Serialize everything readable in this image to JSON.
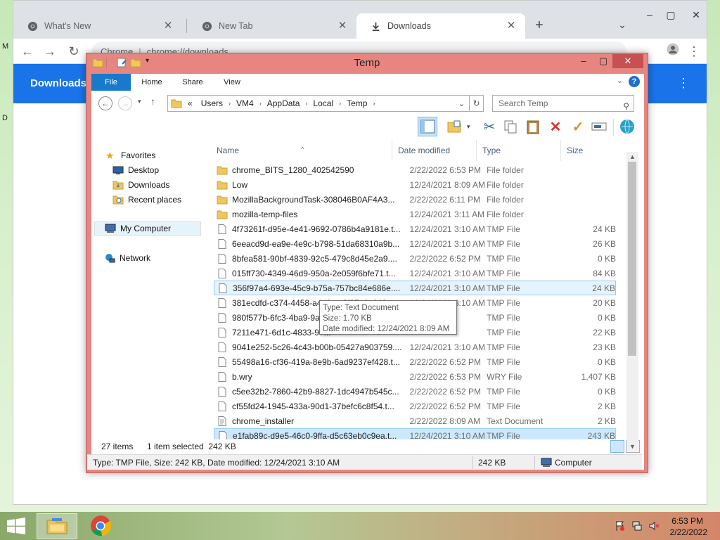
{
  "desktop": {
    "edge_letters": [
      "M",
      "D"
    ]
  },
  "chrome": {
    "tabs": [
      {
        "label": "What's New",
        "icon": "chrome-logo-icon"
      },
      {
        "label": "New Tab",
        "icon": "chrome-logo-icon"
      },
      {
        "label": "Downloads",
        "icon": "download-icon"
      }
    ],
    "omnibox": {
      "site": "Chrome",
      "url": "chrome://downloads"
    },
    "page_title": "Downloads",
    "accent": "#1a73e8"
  },
  "explorer": {
    "title": "Temp",
    "ribbon_tabs": [
      "File",
      "Home",
      "Share",
      "View"
    ],
    "address": [
      "Users",
      "VM4",
      "AppData",
      "Local",
      "Temp"
    ],
    "address_prefix": "«",
    "search_placeholder": "Search Temp",
    "nav": {
      "favorites": "Favorites",
      "desktop": "Desktop",
      "downloads": "Downloads",
      "recent": "Recent places",
      "computer": "My Computer",
      "network": "Network"
    },
    "columns": {
      "name": "Name",
      "date": "Date modified",
      "type": "Type",
      "size": "Size"
    },
    "files": [
      {
        "name": "chrome_BITS_1280_402542590",
        "date": "2/22/2022 6:53 PM",
        "type": "File folder",
        "size": "",
        "icon": "folder-icon"
      },
      {
        "name": "Low",
        "date": "12/24/2021 8:09 AM",
        "type": "File folder",
        "size": "",
        "icon": "folder-icon"
      },
      {
        "name": "MozillaBackgroundTask-308046B0AF4A3...",
        "date": "2/22/2022 6:11 PM",
        "type": "File folder",
        "size": "",
        "icon": "folder-icon"
      },
      {
        "name": "mozilla-temp-files",
        "date": "12/24/2021 3:11 AM",
        "type": "File folder",
        "size": "",
        "icon": "folder-icon"
      },
      {
        "name": "4f73261f-d95e-4e41-9692-0786b4a9181e.t...",
        "date": "12/24/2021 3:10 AM",
        "type": "TMP File",
        "size": "24 KB",
        "icon": "file-icon"
      },
      {
        "name": "6eeacd9d-ea9e-4e9c-b798-51da68310a9b...",
        "date": "12/24/2021 3:10 AM",
        "type": "TMP File",
        "size": "26 KB",
        "icon": "file-icon"
      },
      {
        "name": "8bfea581-90bf-4839-92c5-479c8d45e2a9....",
        "date": "2/22/2022 6:52 PM",
        "type": "TMP File",
        "size": "0 KB",
        "icon": "file-icon"
      },
      {
        "name": "015ff730-4349-46d9-950a-2e059f6bfe71.t...",
        "date": "12/24/2021 3:10 AM",
        "type": "TMP File",
        "size": "84 KB",
        "icon": "file-icon"
      },
      {
        "name": "356f97a4-693e-45c9-b75a-757bc84e686e....",
        "date": "12/24/2021 3:10 AM",
        "type": "TMP File",
        "size": "24 KB",
        "icon": "file-icon",
        "state": "hover"
      },
      {
        "name": "381ecdfd-c374-4458-a4d3-ac3f87e0c643...",
        "date": "12/24/2021 3:10 AM",
        "type": "TMP File",
        "size": "20 KB",
        "icon": "file-icon"
      },
      {
        "name": "980f577b-6fc3-4ba9-9a7...",
        "date": "",
        "type": "TMP File",
        "size": "0 KB",
        "icon": "file-icon"
      },
      {
        "name": "7211e471-6d1c-4833-97...",
        "date": "",
        "type": "TMP File",
        "size": "22 KB",
        "icon": "file-icon"
      },
      {
        "name": "9041e252-5c26-4c43-b00b-05427a903759....",
        "date": "12/24/2021 3:10 AM",
        "type": "TMP File",
        "size": "23 KB",
        "icon": "file-icon"
      },
      {
        "name": "55498a16-cf36-419a-8e9b-6ad9237ef428.t...",
        "date": "2/22/2022 6:52 PM",
        "type": "TMP File",
        "size": "0 KB",
        "icon": "file-icon"
      },
      {
        "name": "b.wry",
        "date": "2/22/2022 6:53 PM",
        "type": "WRY File",
        "size": "1,407 KB",
        "icon": "file-icon"
      },
      {
        "name": "c5ee32b2-7860-42b9-8827-1dc4947b545c...",
        "date": "2/22/2022 6:52 PM",
        "type": "TMP File",
        "size": "0 KB",
        "icon": "file-icon"
      },
      {
        "name": "cf55fd24-1945-433a-90d1-37befc6c8f54.t...",
        "date": "2/22/2022 6:52 PM",
        "type": "TMP File",
        "size": "2 KB",
        "icon": "file-icon"
      },
      {
        "name": "chrome_installer",
        "date": "2/22/2022 8:09 AM",
        "type": "Text Document",
        "size": "2 KB",
        "icon": "text-file-icon"
      },
      {
        "name": "e1fab89c-d9e5-46c0-9ffa-d5c63eb0c9ea.t...",
        "date": "12/24/2021 3:10 AM",
        "type": "TMP File",
        "size": "243 KB",
        "icon": "file-icon",
        "state": "selected"
      }
    ],
    "tooltip": {
      "line1": "Type: Text Document",
      "line2": "Size: 1.70 KB",
      "line3": "Date modified: 12/24/2021 8:09 AM"
    },
    "status": {
      "count": "27 items",
      "selected": "1 item selected  242 KB"
    },
    "statusbar": {
      "details": "Type: TMP File, Size: 242 KB, Date modified: 12/24/2021 3:10 AM",
      "size": "242 KB",
      "location": "Computer"
    }
  },
  "taskbar": {
    "time": "6:53 PM",
    "date": "2/22/2022",
    "apps": [
      "file-explorer-icon",
      "chrome-logo-icon"
    ]
  }
}
